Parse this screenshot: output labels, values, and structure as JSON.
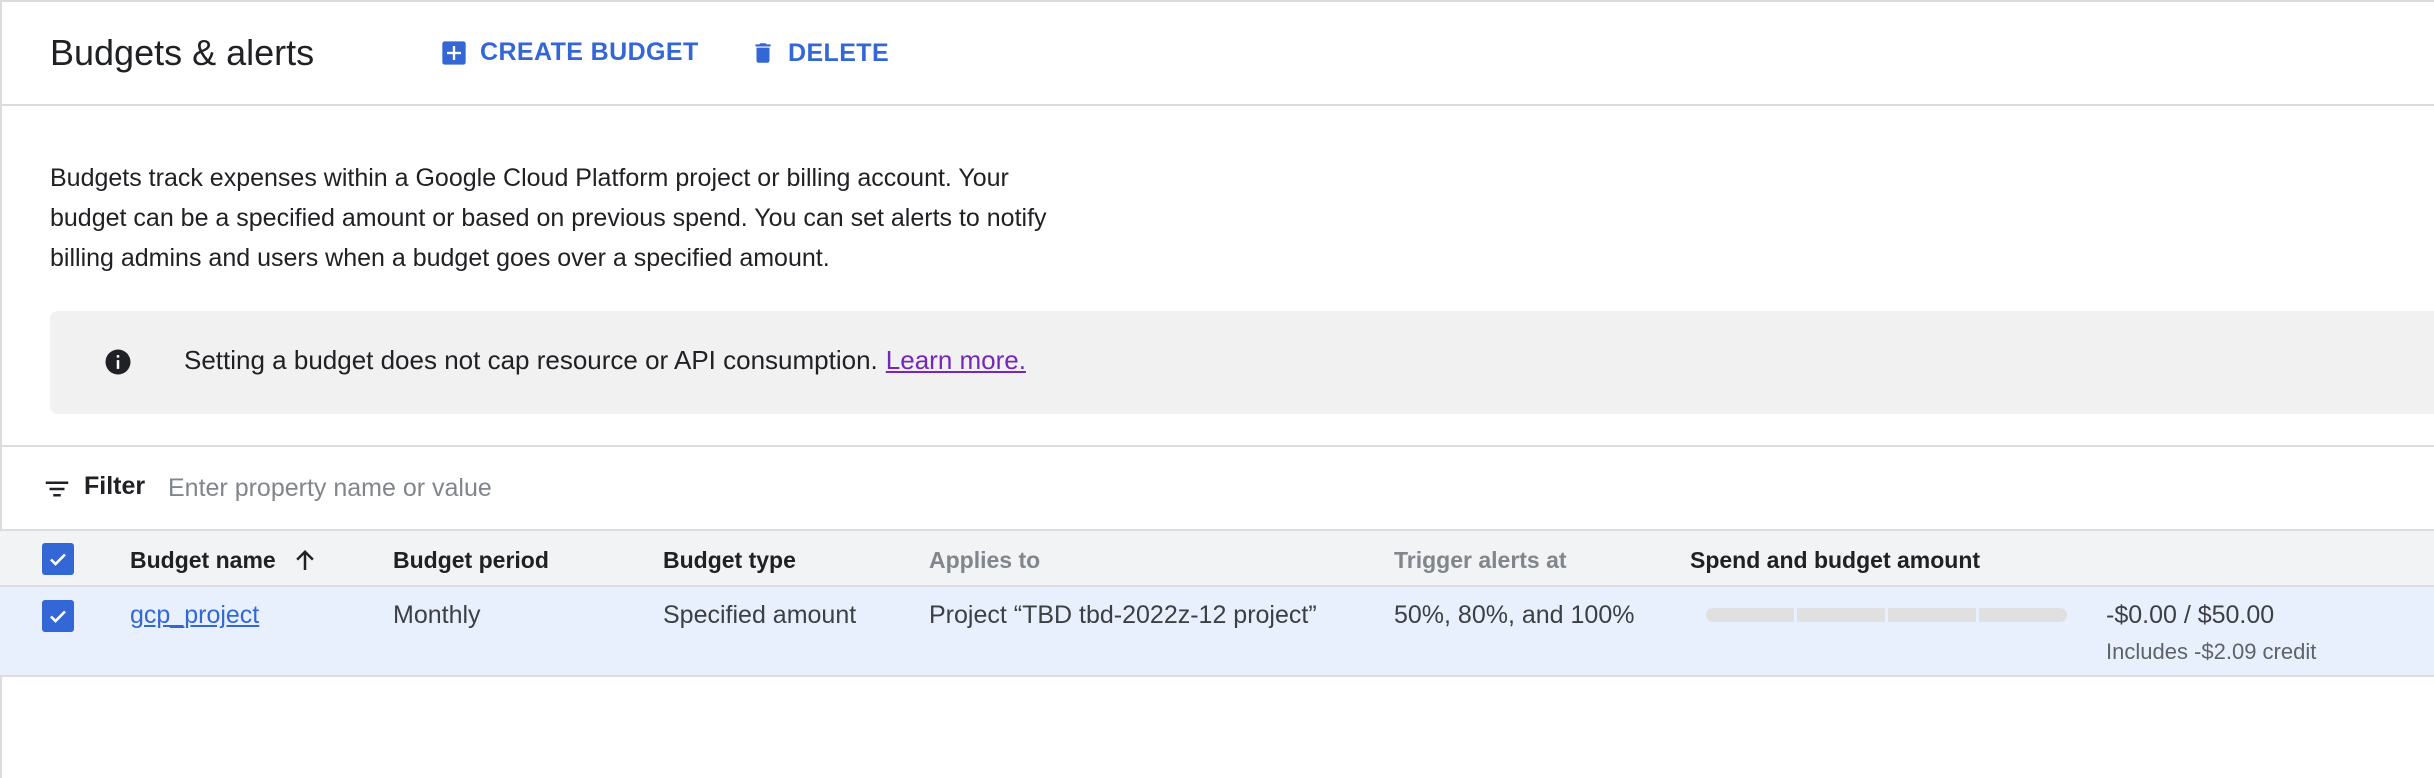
{
  "header": {
    "title": "Budgets & alerts",
    "create_label": "CREATE BUDGET",
    "delete_label": "DELETE"
  },
  "description": "Budgets track expenses within a Google Cloud Platform project or billing account. Your budget can be a specified amount or based on previous spend. You can set alerts to notify billing admins and users when a budget goes over a specified amount.",
  "info_banner": {
    "text": "Setting a budget does not cap resource or API consumption.",
    "link": "Learn more.",
    "icon": "info-icon"
  },
  "filter": {
    "label": "Filter",
    "placeholder": "Enter property name or value",
    "icon": "filter-icon"
  },
  "table": {
    "columns": [
      "Budget name",
      "Budget period",
      "Budget type",
      "Applies to",
      "Trigger alerts at",
      "Spend and budget amount"
    ],
    "sorted_column": "Budget name",
    "sort_direction": "ascending",
    "rows": [
      {
        "name": "gcp_project",
        "period": "Monthly",
        "type": "Specified amount",
        "applies_to": "Project “TBD tbd-2022z-12 project”",
        "trigger": "50%, 80%, and 100%",
        "spend_fraction": 0,
        "spend": "-$0.00 / $50.00",
        "credit": "Includes -$2.09 credit",
        "selected": true
      }
    ]
  },
  "colors": {
    "accent": "#3367d6",
    "link_visited": "#7627bb",
    "selected_row": "#e8f0fe",
    "banner_bg": "#f1f1f1",
    "header_bg": "#f1f3f4"
  }
}
